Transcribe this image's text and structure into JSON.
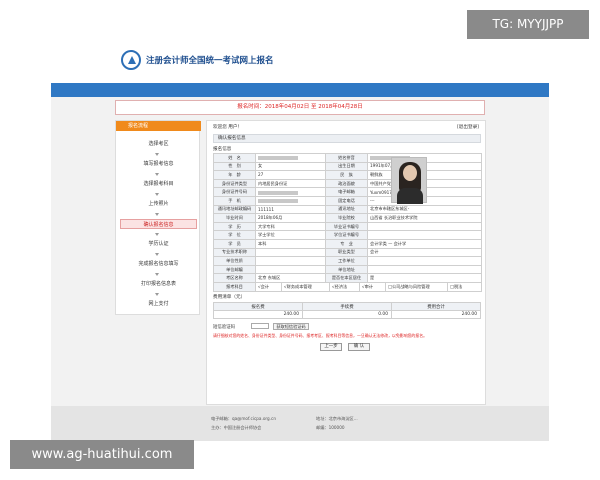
{
  "overlay": {
    "tg_label": "TG: MYYJJPP",
    "watermark": "www.ag-huatihui.com"
  },
  "header": {
    "site_title": "注册会计师全国统一考试网上报名"
  },
  "date_strip": "报名时间：2018年04月02日 至 2018年04月28日",
  "sidebar": {
    "title": "报名流程",
    "steps": [
      "选择考区",
      "填写报考信息",
      "选择报考科目",
      "上传照片",
      "确认报名信息",
      "学历认证",
      "完成报名信息填写",
      "打印报名信息表",
      "网上支付"
    ],
    "active_index": 4
  },
  "main": {
    "welcome": "欢迎您 用户！",
    "logout": "[退出登录]",
    "panel_title": "确认报名信息",
    "section_label": "报名信息",
    "rows": [
      [
        "姓　名",
        "",
        "姓名拼音",
        ""
      ],
      [
        "性　别",
        "女",
        "出生日期",
        "1991年07月21日"
      ],
      [
        "年　龄",
        "27",
        "民　族",
        "朝鲜族"
      ],
      [
        "身份证件类型",
        "内地居民身份证",
        "政治面貌",
        "中国共产党党员"
      ],
      [
        "身份证件号码",
        "",
        "电子邮箱",
        "Yuxm0917@163.com"
      ],
      [
        "手　机",
        "",
        "固定电话",
        "---"
      ],
      [
        "通讯地址邮政编码",
        "111111",
        "通讯地址",
        "北京市市辖区东城区-"
      ],
      [
        "毕业时间",
        "2018年06月",
        "毕业院校",
        "山西省 长治职业技术学院"
      ],
      [
        "学　历",
        "大学专科",
        "毕业证书编号",
        ""
      ],
      [
        "学　位",
        "学士学位",
        "学位证书编号",
        ""
      ],
      [
        "学　员",
        "本科",
        "专　业",
        "会计学类 — 会计学"
      ],
      [
        "专业技术职称",
        "",
        "职业类型",
        "会计"
      ],
      [
        "单位性质",
        "",
        "工作单位",
        ""
      ],
      [
        "单位邮编",
        "",
        "单位地址",
        ""
      ],
      [
        "考区名称",
        "北京 东城区",
        "是否在本区居住",
        "是"
      ]
    ],
    "subjects_label": "报考科目",
    "subjects": [
      "√会计",
      "√财务成本管理",
      "√经济法",
      "√审计",
      "□公司战略与风险管理",
      "□税法"
    ],
    "fee_label": "费用清单（元）",
    "fee_headers": [
      "报名费",
      "手续费",
      "费用合计"
    ],
    "fee_values": [
      "240.00",
      "0.00",
      "240.00"
    ],
    "verify_label": "短信验证码",
    "verify_button": "获取短信验证码",
    "warning": "请仔细核对您的姓名、身份证件类型、身份证件号码、报考考区、报考科目等信息，一旦确认无法修改，以免影响您的报名。",
    "prev_button": "上一步",
    "confirm_button": "确  认"
  },
  "footer": {
    "line1_left": "电子邮箱：qa@mof.cicpa.org.cn",
    "line1_right": "地址：北京市海淀区...",
    "line2_left": "主办：中国注册会计师协会",
    "line2_right": "邮编：100000"
  }
}
